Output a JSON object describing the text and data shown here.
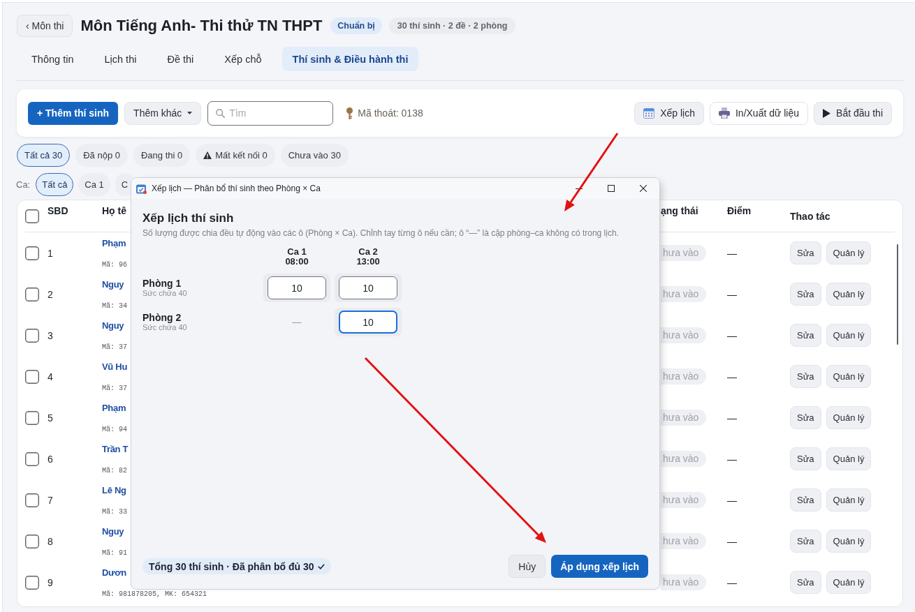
{
  "header": {
    "back_button": "‹ Môn thi",
    "title": "Môn Tiếng Anh- Thi thử TN THPT",
    "status_badge": "Chuẩn bị",
    "summary": "30 thí sinh · 2 đề · 2 phòng"
  },
  "tabs": [
    {
      "label": "Thông tin",
      "selected": false
    },
    {
      "label": "Lịch thi",
      "selected": false
    },
    {
      "label": "Đề thi",
      "selected": false
    },
    {
      "label": "Xếp chỗ",
      "selected": false
    },
    {
      "label": "Thí sinh & Điều hành thi",
      "selected": true
    }
  ],
  "toolbar": {
    "add_button": "+ Thêm thí sinh",
    "more_button": "Thêm khác",
    "search": {
      "placeholder": "Tìm"
    },
    "exit_code": "Mã thoát: 0138",
    "schedule_button": "Xếp lịch",
    "export_button": "In/Xuất dữ liệu",
    "start_button": "Bắt đầu thi"
  },
  "status_filters": [
    {
      "label": "Tất cả 30",
      "selected": true,
      "kind": "plain"
    },
    {
      "label": "Đã nộp 0",
      "selected": false,
      "kind": "plain"
    },
    {
      "label": "Đang thi 0",
      "selected": false,
      "kind": "plain"
    },
    {
      "label": "Mất kết nối 0",
      "selected": false,
      "kind": "alert"
    },
    {
      "label": "Chưa vào 30",
      "selected": false,
      "kind": "plain"
    }
  ],
  "shift_filter": {
    "label": "Ca:",
    "chips": [
      {
        "label": "Tất cả",
        "selected": true
      },
      {
        "label": "Ca 1",
        "selected": false
      },
      {
        "label": "C",
        "selected": false
      }
    ]
  },
  "table": {
    "select_all_checked": false,
    "columns": [
      "SBD",
      "Họ tê",
      "ạng thái",
      "Điểm",
      "Thao tác"
    ],
    "rows": [
      {
        "checked": false,
        "sbd": "1",
        "name": "Phạm",
        "code": "Mã: 96",
        "status": "hưa vào",
        "score": "—",
        "actions": [
          "Sửa",
          "Quản lý"
        ]
      },
      {
        "checked": false,
        "sbd": "2",
        "name": "Nguy",
        "code": "Mã: 34",
        "status": "hưa vào",
        "score": "—",
        "actions": [
          "Sửa",
          "Quản lý"
        ]
      },
      {
        "checked": false,
        "sbd": "3",
        "name": "Nguy",
        "code": "Mã: 37",
        "status": "hưa vào",
        "score": "—",
        "actions": [
          "Sửa",
          "Quản lý"
        ]
      },
      {
        "checked": false,
        "sbd": "4",
        "name": "Vũ Hu",
        "code": "Mã: 37",
        "status": "hưa vào",
        "score": "—",
        "actions": [
          "Sửa",
          "Quản lý"
        ]
      },
      {
        "checked": false,
        "sbd": "5",
        "name": "Phạm",
        "code": "Mã: 94",
        "status": "hưa vào",
        "score": "—",
        "actions": [
          "Sửa",
          "Quản lý"
        ]
      },
      {
        "checked": false,
        "sbd": "6",
        "name": "Trần T",
        "code": "Mã: 82",
        "status": "hưa vào",
        "score": "—",
        "actions": [
          "Sửa",
          "Quản lý"
        ]
      },
      {
        "checked": false,
        "sbd": "7",
        "name": "Lê Ng",
        "code": "Mã: 33",
        "status": "hưa vào",
        "score": "—",
        "actions": [
          "Sửa",
          "Quản lý"
        ]
      },
      {
        "checked": false,
        "sbd": "8",
        "name": "Nguy",
        "code": "Mã: 91",
        "status": "hưa vào",
        "score": "—",
        "actions": [
          "Sửa",
          "Quản lý"
        ]
      },
      {
        "checked": false,
        "sbd": "9",
        "name": "Dươn",
        "code": "Mã: 981878205, MK: 654321",
        "status": "hưa vào",
        "score": "—",
        "actions": [
          "Sửa",
          "Quản lý"
        ]
      }
    ]
  },
  "schedule_dialog": {
    "title": "Xếp lịch — Phân bổ thí sinh theo Phòng × Ca",
    "heading": "Xếp lịch thí sinh",
    "description": "Số lượng được chia đều tự động vào các ô (Phòng × Ca). Chỉnh tay từng ô nếu cần; ô “—” là cặp phòng–ca không có trong lịch.",
    "shifts": [
      {
        "name": "Ca 1",
        "time": "08:00"
      },
      {
        "name": "Ca 2",
        "time": "13:00"
      }
    ],
    "rooms": [
      {
        "name": "Phòng 1",
        "capacity": "Sức chứa 40",
        "cells": [
          {
            "kind": "input",
            "value": "10",
            "focused": false
          },
          {
            "kind": "input",
            "value": "10",
            "focused": false
          }
        ]
      },
      {
        "name": "Phòng 2",
        "capacity": "Sức chứa 40",
        "cells": [
          {
            "kind": "unavailable",
            "text": "—"
          },
          {
            "kind": "input",
            "value": "10",
            "focused": true
          }
        ]
      }
    ],
    "summary": "Tổng 30 thí sinh · Đã phân bổ đủ 30",
    "cancel_button": "Hủy",
    "apply_button": "Áp dụng xếp lịch"
  }
}
